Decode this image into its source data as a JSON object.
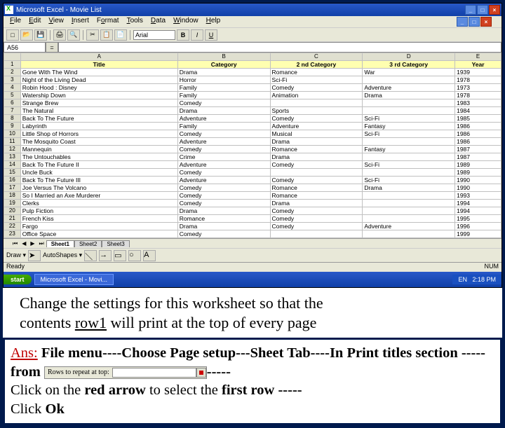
{
  "titlebar": {
    "app": "Microsoft Excel",
    "doc": "Movie List"
  },
  "menubar": [
    "File",
    "Edit",
    "View",
    "Insert",
    "Format",
    "Tools",
    "Data",
    "Window",
    "Help"
  ],
  "font": "Arial",
  "namebox": "A56",
  "columns": [
    "",
    "A",
    "B",
    "C",
    "D",
    "E"
  ],
  "headers": {
    "A": "Title",
    "B": "Category",
    "C": "2 nd Category",
    "D": "3 rd Category",
    "E": "Year"
  },
  "rows": [
    {
      "n": "2",
      "A": "Gone With The Wind",
      "B": "Drama",
      "C": "Romance",
      "D": "War",
      "E": "1939"
    },
    {
      "n": "3",
      "A": "Night of the Living Dead",
      "B": "Horror",
      "C": "Sci-Fi",
      "D": "",
      "E": "1978"
    },
    {
      "n": "4",
      "A": "Robin Hood : Disney",
      "B": "Family",
      "C": "Comedy",
      "D": "Adventure",
      "E": "1973"
    },
    {
      "n": "5",
      "A": "Watership Down",
      "B": "Family",
      "C": "Animation",
      "D": "Drama",
      "E": "1978"
    },
    {
      "n": "6",
      "A": "Strange Brew",
      "B": "Comedy",
      "C": "",
      "D": "",
      "E": "1983"
    },
    {
      "n": "7",
      "A": "The Natural",
      "B": "Drama",
      "C": "Sports",
      "D": "",
      "E": "1984"
    },
    {
      "n": "8",
      "A": "Back To The Future",
      "B": "Adventure",
      "C": "Comedy",
      "D": "Sci-Fi",
      "E": "1985"
    },
    {
      "n": "9",
      "A": "Labyrinth",
      "B": "Family",
      "C": "Adventure",
      "D": "Fantasy",
      "E": "1986"
    },
    {
      "n": "10",
      "A": "Little Shop of Horrors",
      "B": "Comedy",
      "C": "Musical",
      "D": "Sci-Fi",
      "E": "1986"
    },
    {
      "n": "11",
      "A": "The Mosquito Coast",
      "B": "Adventure",
      "C": "Drama",
      "D": "",
      "E": "1986"
    },
    {
      "n": "12",
      "A": "Mannequin",
      "B": "Comedy",
      "C": "Romance",
      "D": "Fantasy",
      "E": "1987"
    },
    {
      "n": "13",
      "A": "The Untouchables",
      "B": "Crime",
      "C": "Drama",
      "D": "",
      "E": "1987"
    },
    {
      "n": "14",
      "A": "Back To The Future II",
      "B": "Adventure",
      "C": "Comedy",
      "D": "Sci-Fi",
      "E": "1989"
    },
    {
      "n": "15",
      "A": "Uncle Buck",
      "B": "Comedy",
      "C": "",
      "D": "",
      "E": "1989"
    },
    {
      "n": "16",
      "A": "Back To The Future III",
      "B": "Adventure",
      "C": "Comedy",
      "D": "Sci-Fi",
      "E": "1990"
    },
    {
      "n": "17",
      "A": "Joe Versus The Volcano",
      "B": "Comedy",
      "C": "Romance",
      "D": "Drama",
      "E": "1990"
    },
    {
      "n": "18",
      "A": "So I Married an Axe Murderer",
      "B": "Comedy",
      "C": "Romance",
      "D": "",
      "E": "1993"
    },
    {
      "n": "19",
      "A": "Clerks",
      "B": "Comedy",
      "C": "Drama",
      "D": "",
      "E": "1994"
    },
    {
      "n": "20",
      "A": "Pulp Fiction",
      "B": "Drama",
      "C": "Comedy",
      "D": "",
      "E": "1994"
    },
    {
      "n": "21",
      "A": "French Kiss",
      "B": "Romance",
      "C": "Comedy",
      "D": "",
      "E": "1995"
    },
    {
      "n": "22",
      "A": "Fargo",
      "B": "Drama",
      "C": "Comedy",
      "D": "Adventure",
      "E": "1996"
    },
    {
      "n": "23",
      "A": "Office Space",
      "B": "Comedy",
      "C": "",
      "D": "",
      "E": "1999"
    }
  ],
  "sheet_tabs": [
    "Sheet1",
    "Sheet2",
    "Sheet3"
  ],
  "status_left": "Ready",
  "status_right": "NUM",
  "taskbar": {
    "start": "start",
    "app": "Microsoft Excel - Movi...",
    "tray_lang": "EN",
    "clock": "2:18 PM"
  },
  "question": {
    "line1a": "Change the settings for this worksheet so that the",
    "line2a": "contents ",
    "row1": "row1",
    "line2b": " will print at the top of every page"
  },
  "answer": {
    "ans": "Ans:",
    "t1": " File menu----Choose Page setup---Sheet Tab----In Print titles section -----from ",
    "rowslbl": "Rows to repeat at top:",
    "t2a": "Click on the ",
    "red": "red arrow",
    "t2b": " to select the ",
    "fr": "first row",
    "t2c": " -----",
    "t3": "Click ",
    "ok": "Ok"
  }
}
